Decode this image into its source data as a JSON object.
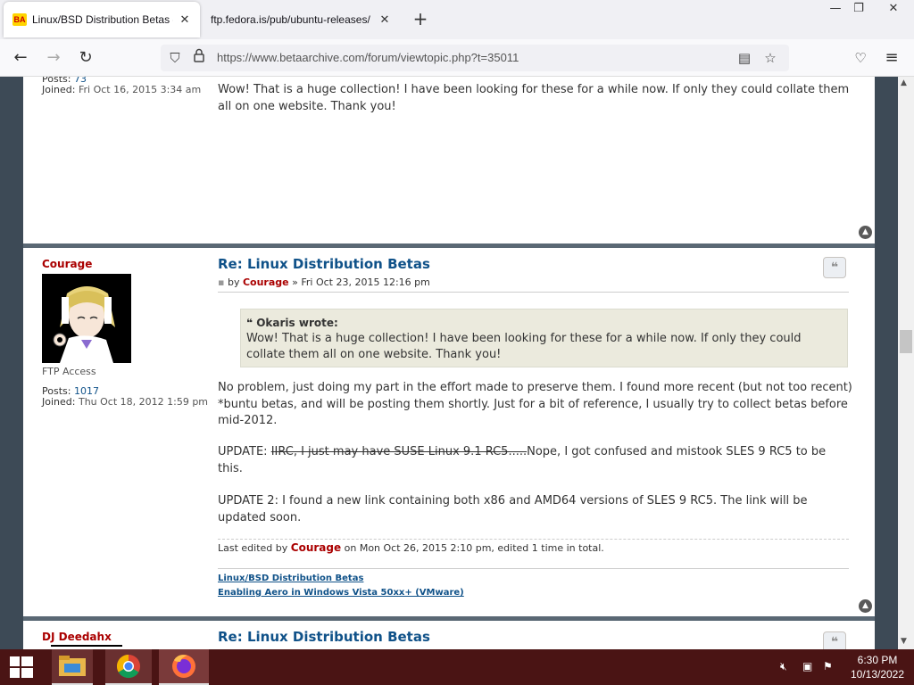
{
  "browser": {
    "tabs": [
      {
        "title": "Linux/BSD Distribution Betas - E",
        "favicon": "BA",
        "active": true
      },
      {
        "title": "ftp.fedora.is/pub/ubuntu-releases/",
        "active": false
      }
    ],
    "new_tab": "+",
    "url": "https://www.betaarchive.com/forum/viewtopic.php?t=35011"
  },
  "prev_post": {
    "posts_label": "Posts:",
    "posts_value": "73",
    "joined_label": "Joined:",
    "joined_value": "Fri Oct 16, 2015 3:34 am",
    "text": "Wow! That is a huge collection! I have been looking for these for a while now. If only they could collate them all on one website. Thank you!"
  },
  "post": {
    "author": "Courage",
    "rank": "FTP Access",
    "posts_label": "Posts:",
    "posts_value": "1017",
    "joined_label": "Joined:",
    "joined_value": "Thu Oct 18, 2012 1:59 pm",
    "title": "Re: Linux Distribution Betas",
    "meta_by": "by",
    "meta_author": "Courage",
    "meta_date": "» Fri Oct 23, 2015 12:16 pm",
    "quote_author": "Okaris wrote:",
    "quote_text": "Wow! That is a huge collection! I have been looking for these for a while now. If only they could collate them all on one website. Thank you!",
    "para1": "No problem, just doing my part in the effort made to preserve them. I found more recent (but not too recent) *buntu betas, and will be posting them shortly. Just for a bit of reference, I usually try to collect betas before mid-2012.",
    "para2_prefix": "UPDATE: ",
    "para2_struck": "IIRC, I just may have SUSE Linux 9.1 RC5.....",
    "para2_rest": "Nope, I got confused and mistook SLES 9 RC5 to be this.",
    "para3": "UPDATE 2: I found a new link containing both x86 and AMD64 versions of SLES 9 RC5. The link will be updated soon.",
    "edited_prefix": "Last edited by",
    "edited_author": "Courage",
    "edited_suffix": "on Mon Oct 26, 2015 2:10 pm, edited 1 time in total.",
    "signature_links": [
      "Linux/BSD Distribution Betas",
      "Enabling Aero in Windows Vista 50xx+ (VMware)"
    ]
  },
  "next_post": {
    "author": "DJ Deedahx",
    "title": "Re: Linux Distribution Betas"
  },
  "taskbar": {
    "time": "6:30 PM",
    "date": "10/13/2022"
  },
  "colors": {
    "author_red": "#aa0000",
    "link_blue": "#105289",
    "taskbar": "#4a1414",
    "quote_bg": "#ebeadd"
  }
}
